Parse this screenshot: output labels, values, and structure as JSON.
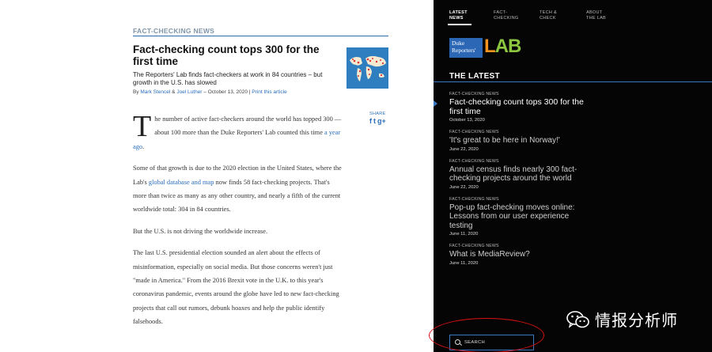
{
  "article": {
    "kicker": "FACT-CHECKING NEWS",
    "headline": "Fact-checking count tops 300 for the first time",
    "dek": "The Reporters' Lab finds fact-checkers at work in 84 countries – but growth in the U.S. has slowed",
    "byline": {
      "by": "By",
      "author1": "Mark Stencel",
      "amp": "&",
      "author2": "Joel Luther",
      "date": "– October 13, 2020",
      "sep": "|",
      "print": "Print this article"
    },
    "share": {
      "label": "SHARE",
      "icons": [
        "facebook-icon",
        "twitter-icon",
        "google-plus-icon"
      ],
      "glyphs": [
        "f",
        "t",
        "g+"
      ]
    },
    "paragraphs": {
      "p1_dropcap": "T",
      "p1_text": "he number of active fact-checkers around the world has topped 300 — about 100 more than the Duke Reporters' Lab counted this time ",
      "p1_link": "a year ago",
      "p1_end": ".",
      "p2_text": "Some of that growth is due to the 2020 election in the United States, where the Lab's ",
      "p2_link": "global database and map",
      "p2_end": " now finds 58 fact-checking projects. That's more than twice as many as any other country, and nearly a fifth of the current worldwide total: 304 in 84 countries.",
      "p3": "But the U.S. is not driving the worldwide increase.",
      "p4": "The last U.S. presidential election sounded an alert about the effects of misinformation, especially on social media. But those concerns weren't just \"made in America.\" From the 2016 Brexit vote in the U.K. to this year's coronavirus pandemic, events around the globe have led to new fact-checking projects that call out rumors, debunk hoaxes and help the public identify falsehoods."
    }
  },
  "sidebar": {
    "nav": [
      {
        "line1": "LATEST",
        "line2": "NEWS",
        "active": true
      },
      {
        "line1": "FACT-",
        "line2": "CHECKING",
        "active": false
      },
      {
        "line1": "TECH &",
        "line2": "CHECK",
        "active": false
      },
      {
        "line1": "ABOUT",
        "line2": "THE LAB",
        "active": false
      }
    ],
    "logo": {
      "duke_line1": "Duke",
      "duke_line2": "Reporters'",
      "lab_l": "L",
      "lab_a": "A",
      "lab_b": "B"
    },
    "section_title": "THE LATEST",
    "news": [
      {
        "category": "FACT-CHECKING NEWS",
        "title": "Fact-checking count tops 300 for the first time",
        "date": "October 13, 2020",
        "current": true
      },
      {
        "category": "FACT-CHECKING NEWS",
        "title": "'It's great to be here in Norway!'",
        "date": "June 22, 2020",
        "current": false
      },
      {
        "category": "FACT-CHECKING NEWS",
        "title": "Annual census finds nearly 300 fact-checking projects around the world",
        "date": "June 22, 2020",
        "current": false
      },
      {
        "category": "FACT-CHECKING NEWS",
        "title": "Pop-up fact-checking moves online: Lessons from our user experience testing",
        "date": "June 11, 2020",
        "current": false
      },
      {
        "category": "FACT-CHECKING NEWS",
        "title": "What is MediaReview?",
        "date": "June 11, 2020",
        "current": false
      }
    ],
    "search_label": "SEARCH",
    "watermark": "情报分析师"
  },
  "colors": {
    "accent": "#3a78c2",
    "link": "#2a6ebb",
    "sidebar_bg": "#050505",
    "annotation": "#dd1111",
    "lab_green": "#8dc63f",
    "lab_orange": "#f7941d"
  }
}
